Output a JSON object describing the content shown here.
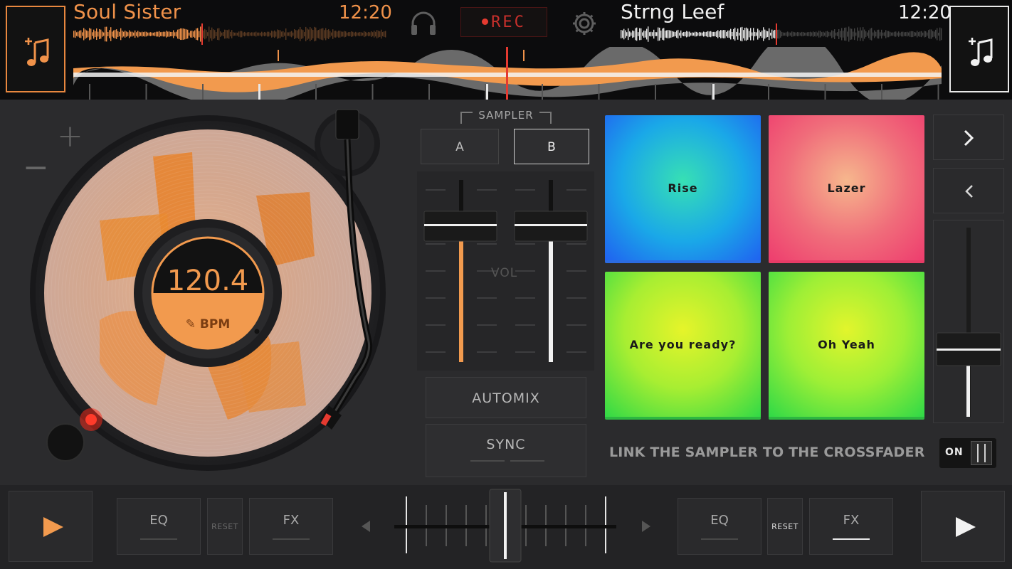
{
  "deck_a": {
    "track_title": "Soul Sister",
    "time": "12:20",
    "bpm_value": "120.4",
    "bpm_label": "BPM",
    "pitch_plus": "+",
    "pitch_minus": "−",
    "accent_color": "#f0924a"
  },
  "deck_b": {
    "track_title": "Strng Leef",
    "time": "12:20",
    "accent_color": "#f2f2f2"
  },
  "header": {
    "rec_label": "REC"
  },
  "sampler": {
    "label": "SAMPLER",
    "bank_a": "A",
    "bank_b": "B",
    "selected_bank": "B",
    "volume_label": "VOL",
    "pads": [
      {
        "label": "Rise"
      },
      {
        "label": "Lazer"
      },
      {
        "label": "Are you ready?"
      },
      {
        "label": "Oh Yeah"
      }
    ]
  },
  "controls": {
    "automix_label": "AUTOMIX",
    "sync_label": "SYNC",
    "link_text": "LINK THE SAMPLER TO THE CROSSFADER",
    "link_toggle": "ON"
  },
  "bottom_bar": {
    "left": {
      "eq_label": "EQ",
      "reset_label": "RESET",
      "fx_label": "FX"
    },
    "right": {
      "eq_label": "EQ",
      "reset_label": "RESET",
      "fx_label": "FX"
    }
  },
  "icons": {
    "add_track": "music-note-plus-icon",
    "headphones": "headphones-icon",
    "settings": "gear-icon",
    "next": "chevron-right-icon",
    "prev": "chevron-left-icon",
    "play": "play-icon"
  }
}
